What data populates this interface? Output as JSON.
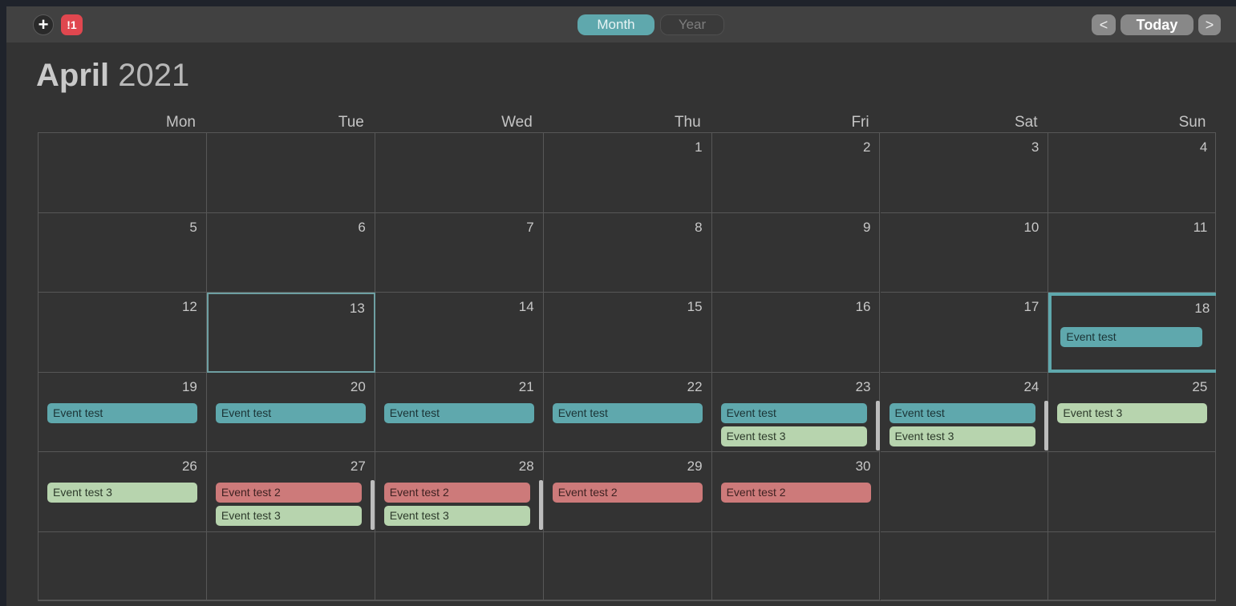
{
  "toolbar": {
    "add_label": "+",
    "alert_label": "!1",
    "month_tab": "Month",
    "year_tab": "Year",
    "prev_label": "<",
    "today_label": "Today",
    "next_label": ">"
  },
  "heading": {
    "month": "April",
    "year": "2021"
  },
  "weekdays": [
    "Mon",
    "Tue",
    "Wed",
    "Thu",
    "Fri",
    "Sat",
    "Sun"
  ],
  "weeks": [
    [
      "",
      "",
      "",
      "1",
      "2",
      "3",
      "4"
    ],
    [
      "5",
      "6",
      "7",
      "8",
      "9",
      "10",
      "11"
    ],
    [
      "12",
      "13",
      "14",
      "15",
      "16",
      "17",
      "18"
    ],
    [
      "19",
      "20",
      "21",
      "22",
      "23",
      "24",
      "25"
    ],
    [
      "26",
      "27",
      "28",
      "29",
      "30",
      "",
      ""
    ],
    [
      "",
      "",
      "",
      "",
      "",
      "",
      ""
    ]
  ],
  "today": {
    "week": 2,
    "day": 1
  },
  "selected": {
    "week": 2,
    "day": 6
  },
  "colors": {
    "teal": "#5fa8ad",
    "green": "#b7d4ae",
    "red": "#cd7a7a",
    "alert": "#e0474f"
  },
  "events": [
    {
      "week": 2,
      "day": 6,
      "slot": 0,
      "title": "Event test",
      "color": "teal"
    },
    {
      "week": 3,
      "day": 0,
      "slot": 0,
      "title": "Event test",
      "color": "teal"
    },
    {
      "week": 3,
      "day": 1,
      "slot": 0,
      "title": "Event test",
      "color": "teal"
    },
    {
      "week": 3,
      "day": 2,
      "slot": 0,
      "title": "Event test",
      "color": "teal"
    },
    {
      "week": 3,
      "day": 3,
      "slot": 0,
      "title": "Event test",
      "color": "teal"
    },
    {
      "week": 3,
      "day": 4,
      "slot": 0,
      "title": "Event test",
      "color": "teal"
    },
    {
      "week": 3,
      "day": 4,
      "slot": 1,
      "title": "Event test 3",
      "color": "green"
    },
    {
      "week": 3,
      "day": 5,
      "slot": 0,
      "title": "Event test",
      "color": "teal"
    },
    {
      "week": 3,
      "day": 5,
      "slot": 1,
      "title": "Event test 3",
      "color": "green"
    },
    {
      "week": 3,
      "day": 6,
      "slot": 0,
      "title": "Event test 3",
      "color": "green"
    },
    {
      "week": 4,
      "day": 0,
      "slot": 0,
      "title": "Event test 3",
      "color": "green"
    },
    {
      "week": 4,
      "day": 1,
      "slot": 0,
      "title": "Event test 2",
      "color": "red"
    },
    {
      "week": 4,
      "day": 1,
      "slot": 1,
      "title": "Event test 3",
      "color": "green"
    },
    {
      "week": 4,
      "day": 2,
      "slot": 0,
      "title": "Event test 2",
      "color": "red"
    },
    {
      "week": 4,
      "day": 2,
      "slot": 1,
      "title": "Event test 3",
      "color": "green"
    },
    {
      "week": 4,
      "day": 3,
      "slot": 0,
      "title": "Event test 2",
      "color": "red"
    },
    {
      "week": 4,
      "day": 4,
      "slot": 0,
      "title": "Event test 2",
      "color": "red"
    }
  ],
  "overflow_indicators": [
    {
      "week": 3,
      "day": 4
    },
    {
      "week": 3,
      "day": 5
    },
    {
      "week": 4,
      "day": 1
    },
    {
      "week": 4,
      "day": 2
    }
  ]
}
